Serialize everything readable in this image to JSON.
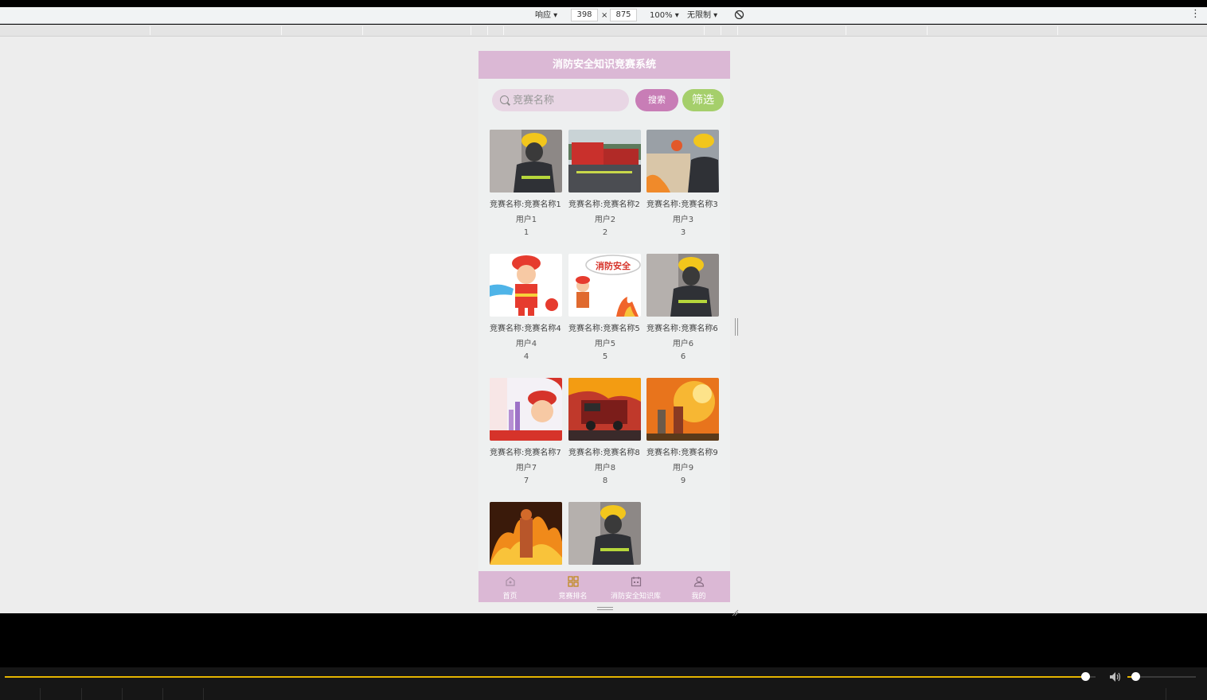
{
  "devtools": {
    "device_mode": "响应 ▾",
    "width": "398",
    "times": "×",
    "height": "875",
    "zoom": "100% ▾",
    "throttle": "无限制 ▾",
    "rotate_icon": "rotate-icon",
    "more": "⋮"
  },
  "app": {
    "title": "消防安全知识竞赛系统",
    "search": {
      "placeholder": "竞赛名称",
      "value": ""
    },
    "search_button": "搜索",
    "filter_button": "筛选"
  },
  "cards": [
    {
      "name": "竞赛名称:竞赛名称1",
      "user": "用户1",
      "num": "1",
      "image": "firefighter-mask"
    },
    {
      "name": "竞赛名称:竞赛名称2",
      "user": "用户2",
      "num": "2",
      "image": "fire-truck-crew"
    },
    {
      "name": "竞赛名称:竞赛名称3",
      "user": "用户3",
      "num": "3",
      "image": "firefighter-map"
    },
    {
      "name": "竞赛名称:竞赛名称4",
      "user": "用户4",
      "num": "4",
      "image": "cartoon-firefighter-hose"
    },
    {
      "name": "竞赛名称:竞赛名称5",
      "user": "用户5",
      "num": "5",
      "image": "cartoon-fire-safety"
    },
    {
      "name": "竞赛名称:竞赛名称6",
      "user": "用户6",
      "num": "6",
      "image": "firefighter-mask"
    },
    {
      "name": "竞赛名称:竞赛名称7",
      "user": "用户7",
      "num": "7",
      "image": "cartoon-fire-safety-poster"
    },
    {
      "name": "竞赛名称:竞赛名称8",
      "user": "用户8",
      "num": "8",
      "image": "fire-truck-flames"
    },
    {
      "name": "竞赛名称:竞赛名称9",
      "user": "用户9",
      "num": "9",
      "image": "firefighters-flames"
    },
    {
      "name": "",
      "user": "",
      "num": "",
      "image": "firefighter-in-fire"
    },
    {
      "name": "",
      "user": "",
      "num": "",
      "image": "firefighter-mask"
    }
  ],
  "poster_text": "消防安全",
  "tabbar": [
    {
      "label": "首页",
      "icon": "home-icon"
    },
    {
      "label": "竞赛排名",
      "icon": "grid-icon"
    },
    {
      "label": "消防安全知识库",
      "icon": "calendar-icon"
    },
    {
      "label": "我的",
      "icon": "user-icon"
    }
  ],
  "colors": {
    "header": "#dbb8d5",
    "search_button": "#c87db6",
    "filter_button": "#a5cf6b",
    "progress": "#e5b500"
  },
  "player": {
    "progress": 0.995,
    "volume": 0.08
  }
}
